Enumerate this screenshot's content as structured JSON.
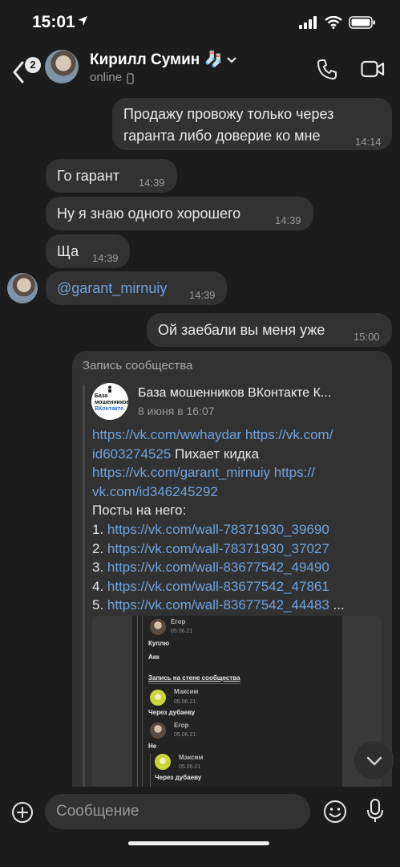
{
  "status_bar": {
    "time": "15:01"
  },
  "header": {
    "back_badge": "2",
    "contact_name": "Кирилл Сумин 🧦",
    "contact_status": "online"
  },
  "messages": [
    {
      "line1": "Продажу провожу только через",
      "line2": "гаранта либо доверие ко мне",
      "time": "14:14"
    },
    {
      "text": "Го гарант",
      "time": "14:39"
    },
    {
      "text": "Ну я знаю одного хорошего",
      "time": "14:39"
    },
    {
      "text": "Ща",
      "time": "14:39"
    },
    {
      "text": "@garant_mirnuiy",
      "time": "14:39"
    },
    {
      "text": "Ой заебали вы меня уже",
      "time": "15:00"
    }
  ],
  "repost": {
    "label": "Запись сообщества",
    "group_name": "База мошенников ВКонтакте  К...",
    "logo_text_line1": "База",
    "logo_text_line2": "мошенников",
    "logo_text_line3": "ВКонтакте.",
    "date": "8 июня в 16:07",
    "link1": "https://vk.com/wwhaydar",
    "link2a": "https://vk.com/",
    "link2b": "id603274525",
    "suffix2": " Пихает кидка",
    "link3": "https://vk.com/garant_mirnuiy",
    "link4a": "https://",
    "link4b": "vk.com/id346245292",
    "posts_label": "Посты на него:",
    "posts": [
      {
        "num": "1. ",
        "url": "https://vk.com/wall-78371930_39690"
      },
      {
        "num": "2. ",
        "url": "https://vk.com/wall-78371930_37027"
      },
      {
        "num": "3. ",
        "url": "https://vk.com/wall-83677542_49490"
      },
      {
        "num": "4. ",
        "url": "https://vk.com/wall-83677542_47861"
      },
      {
        "num": "5. ",
        "url": "https://vk.com/wall-83677542_44483"
      }
    ],
    "posts_more": " ...",
    "screenshot": {
      "name1": "Егор",
      "date1": "05.06.21",
      "msg1a": "Куплю",
      "msg1b": "Акк",
      "wall_label": "Запись на стене сообщества",
      "name2": "Максим",
      "date2": "05.06.21",
      "msg2": "Через дубаеву",
      "name3": "Егор",
      "date3": "05.06.21",
      "msg3": "Не",
      "name4": "Максим",
      "date4": "05.06.21",
      "msg4": "Через дубаеву"
    }
  },
  "composer": {
    "placeholder": "Сообщение"
  },
  "colors": {
    "background": "#1c1c1c",
    "bubble": "#323232",
    "link": "#6fa3de",
    "time": "#9a9a9a"
  }
}
